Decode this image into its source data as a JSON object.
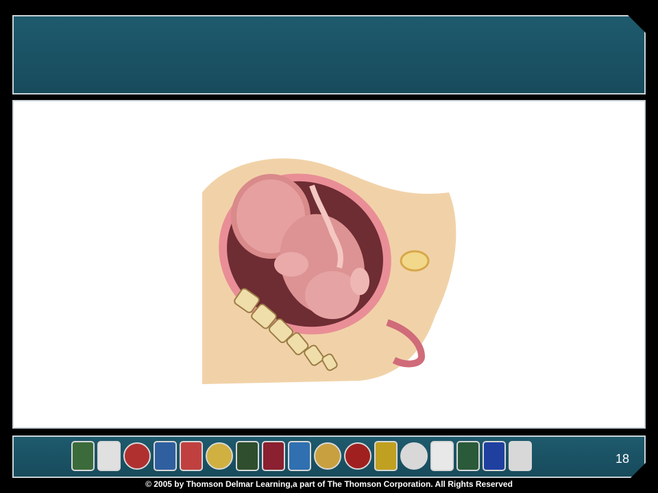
{
  "slide": {
    "page_number": "18",
    "copyright": "© 2005 by Thomson Delmar Learning,a part of The Thomson Corporation. All Rights Reserved"
  },
  "footer": {
    "patches": [
      {
        "icon": "ems-patch-icon",
        "color": "#3b6b3b",
        "shape": "square"
      },
      {
        "icon": "county-patch-icon",
        "color": "#e0e0e0",
        "shape": "shield"
      },
      {
        "icon": "fire-rescue-patch-icon",
        "color": "#b03030",
        "shape": "round"
      },
      {
        "icon": "star-of-life-patch-icon",
        "color": "#2f5f9f",
        "shape": "shield"
      },
      {
        "icon": "medical-patch-icon",
        "color": "#c04040",
        "shape": "square"
      },
      {
        "icon": "iowa-patch-icon",
        "color": "#d0b040",
        "shape": "round"
      },
      {
        "icon": "boston-patch-icon",
        "color": "#2e4e2e",
        "shape": "shield"
      },
      {
        "icon": "ems-medical-patch-icon",
        "color": "#8a2030",
        "shape": "square"
      },
      {
        "icon": "fountain-patch-icon",
        "color": "#3070b0",
        "shape": "shield"
      },
      {
        "icon": "seal-patch-icon",
        "color": "#c8a040",
        "shape": "round"
      },
      {
        "icon": "maltese-cross-patch-icon",
        "color": "#a02020",
        "shape": "round"
      },
      {
        "icon": "county-ems-patch-icon",
        "color": "#c0a020",
        "shape": "square"
      },
      {
        "icon": "mountain-patch-icon",
        "color": "#d8d8d8",
        "shape": "round"
      },
      {
        "icon": "middleton-patch-icon",
        "color": "#e8e8e8",
        "shape": "shield"
      },
      {
        "icon": "ems-green-patch-icon",
        "color": "#2a5a3a",
        "shape": "square"
      },
      {
        "icon": "texas-patch-icon",
        "color": "#2040a0",
        "shape": "shield"
      },
      {
        "icon": "medic-patch-icon",
        "color": "#d8d8d8",
        "shape": "shield"
      }
    ]
  },
  "illustration": {
    "icon": "fetus-in-utero-illustration"
  }
}
